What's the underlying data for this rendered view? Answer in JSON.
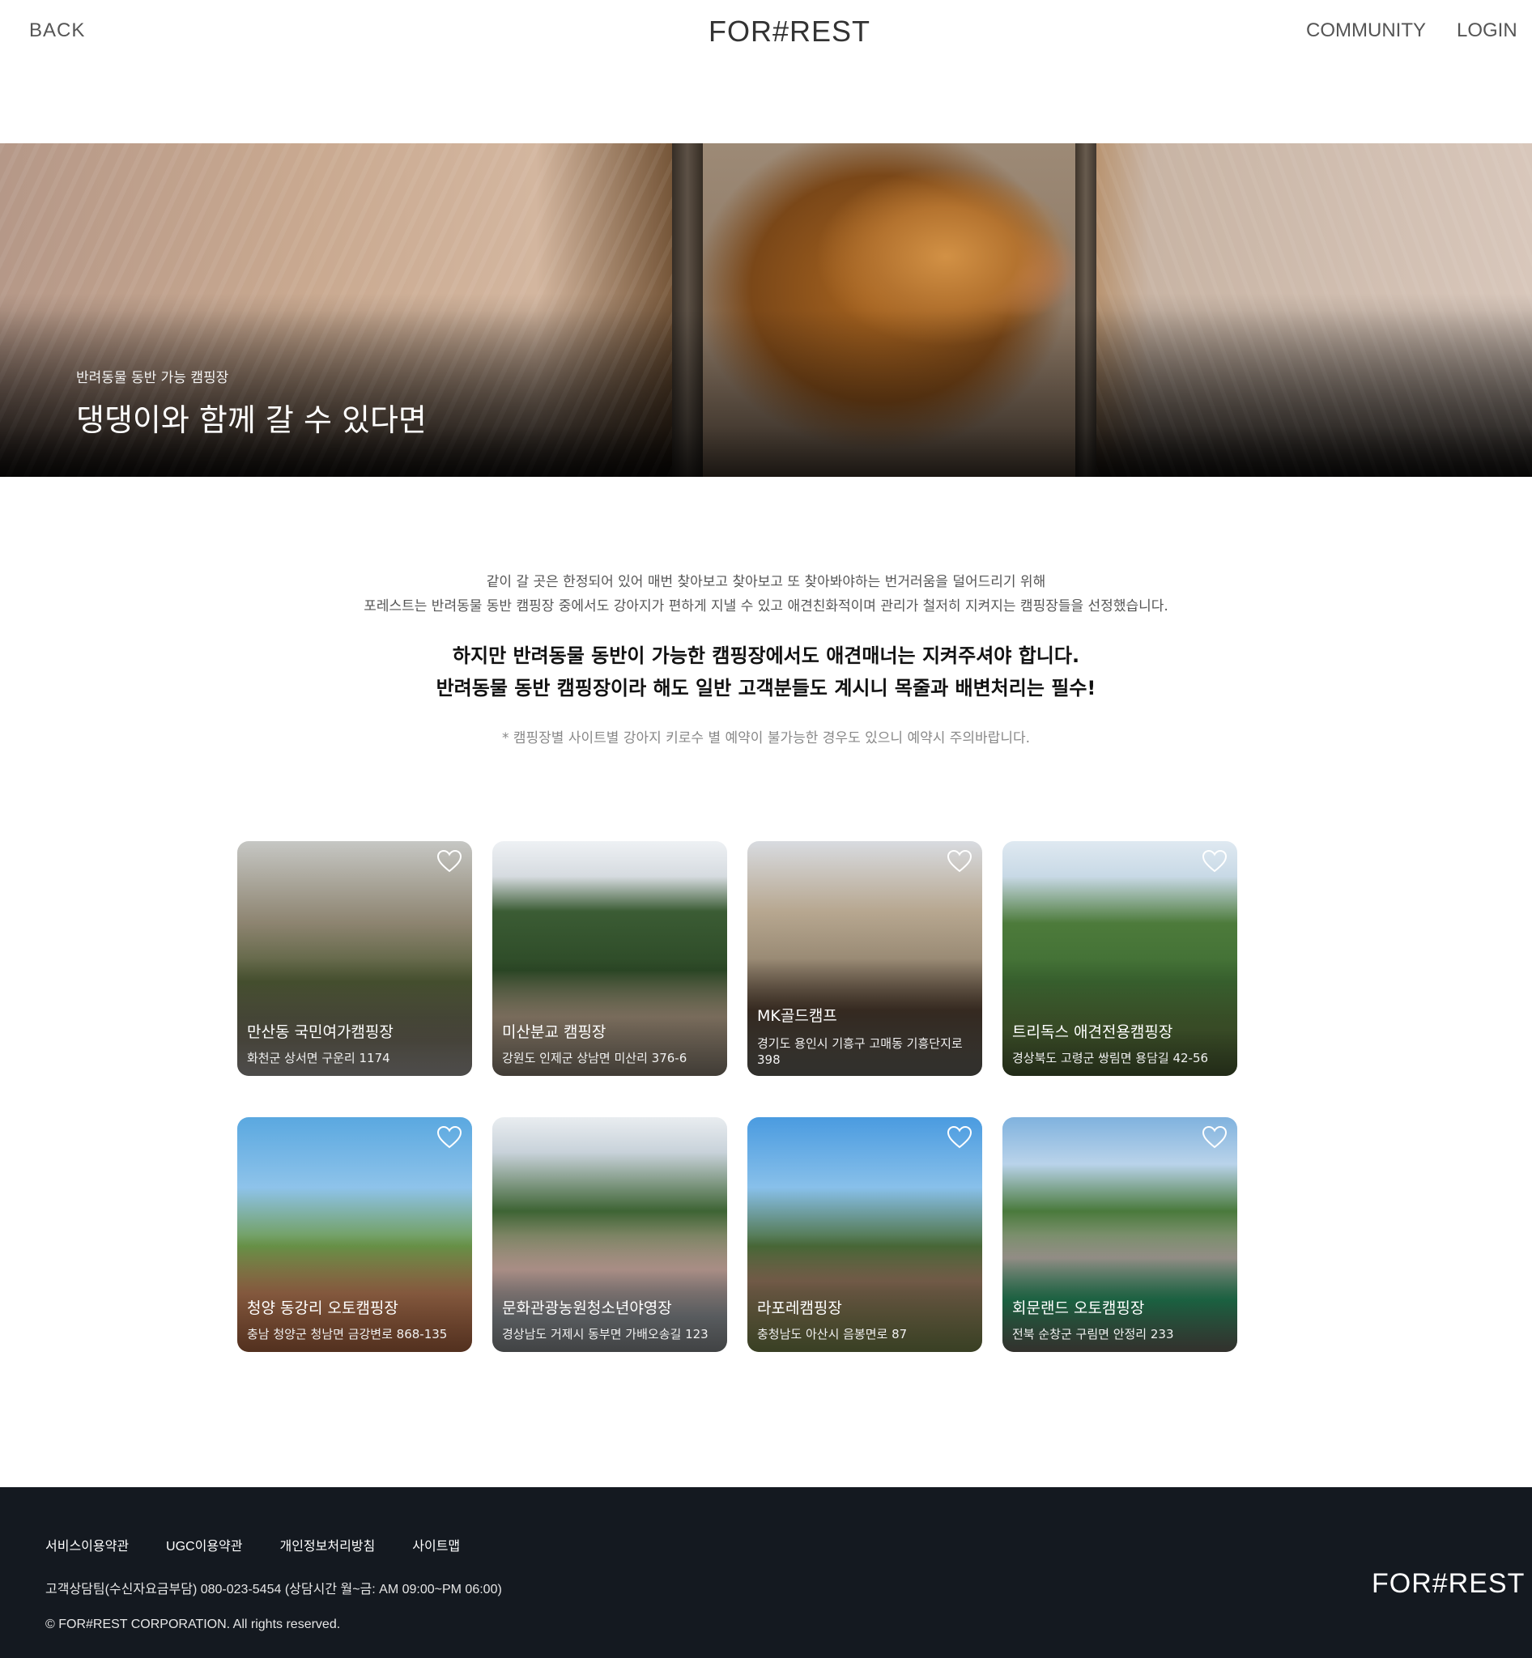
{
  "header": {
    "back_label": "BACK",
    "logo": "FOR#REST",
    "community_label": "COMMUNITY",
    "login_label": "LOGIN"
  },
  "hero": {
    "subtitle": "반려동물 동반 가능 캠핑장",
    "title": "댕댕이와 함께 갈 수 있다면"
  },
  "intro": {
    "line1": "같이 갈 곳은 한정되어 있어 매번 찾아보고 찾아보고 또 찾아봐야하는 번거러움을 덜어드리기 위해",
    "line2": "포레스트는 반려동물 동반 캠핑장 중에서도 강아지가 편하게 지낼 수 있고 애견친화적이며 관리가 철저히 지켜지는 캠핑장들을 선정했습니다."
  },
  "notice": {
    "line1": "하지만 반려동물 동반이 가능한 캠핑장에서도 애견매너는 지켜주셔야 합니다.",
    "line2": "반려동물 동반 캠핑장이라 해도 일반 고객분들도 계시니 목줄과 배변처리는 필수!"
  },
  "footnote": "* 캠핑장별 사이트별 강아지 키로수 별 예약이 불가능한 경우도 있으니 예약시 주의바랍니다.",
  "campsites": [
    {
      "name": "만산동 국민여가캠핑장",
      "address": "화천군 상서면 구운리 1174"
    },
    {
      "name": "미산분교 캠핑장",
      "address": "강원도 인제군 상남면 미산리 376-6"
    },
    {
      "name": "MK골드캠프",
      "address": "경기도 용인시 기흥구 고매동 기흥단지로 398"
    },
    {
      "name": "트리독스 애견전용캠핑장",
      "address": "경상북도 고령군 쌍림면 용담길 42-56"
    },
    {
      "name": "청양 동강리 오토캠핑장",
      "address": "충남 청양군 청남면 금강변로 868-135"
    },
    {
      "name": "문화관광농원청소년야영장",
      "address": "경상남도 거제시 동부면 가배오송길 123"
    },
    {
      "name": "라포레캠핑장",
      "address": "충청남도 아산시 음봉면로 87"
    },
    {
      "name": "회문랜드 오토캠핑장",
      "address": "전북 순창군 구림면 안정리 233"
    }
  ],
  "footer": {
    "links": [
      "서비스이용약관",
      "UGC이용약관",
      "개인정보처리방침",
      "사이트맵"
    ],
    "customer_service": "고객상담팀(수신자요금부담) 080-023-5454 (상담시간 월~금: AM 09:00~PM 06:00)",
    "copyright": "© FOR#REST CORPORATION. All rights reserved.",
    "logo": "FOR#REST"
  }
}
